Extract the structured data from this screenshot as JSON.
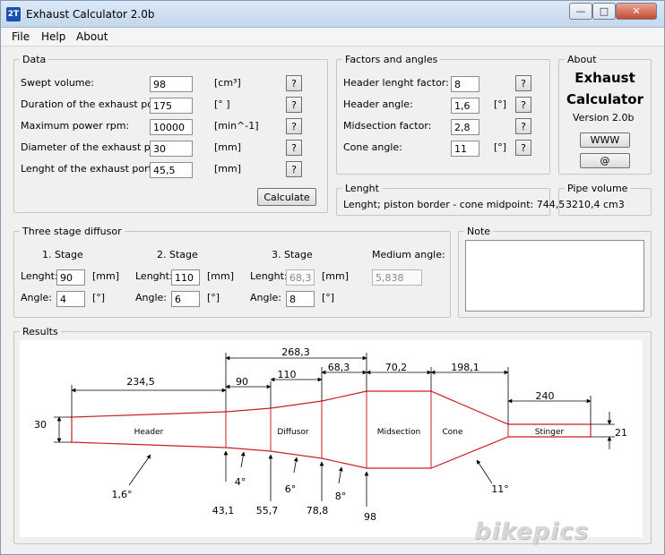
{
  "window": {
    "title": "Exhaust Calculator 2.0b",
    "icon": "2T"
  },
  "menu": [
    "File",
    "Help",
    "About"
  ],
  "data": {
    "legend": "Data",
    "rows": [
      {
        "label": "Swept volume:",
        "value": "98",
        "unit": "[cm³]"
      },
      {
        "label": "Duration of the exhaust port:",
        "value": "175",
        "unit": "[° ]"
      },
      {
        "label": "Maximum power rpm:",
        "value": "10000",
        "unit": "[min^-1]"
      },
      {
        "label": "Diameter of the exhaust port:",
        "value": "30",
        "unit": "[mm]"
      },
      {
        "label": "Lenght of the exhaust port:",
        "value": "45,5",
        "unit": "[mm]"
      }
    ],
    "help_label": "?",
    "calculate_label": "Calculate"
  },
  "factors": {
    "legend": "Factors and angles",
    "rows": [
      {
        "label": "Header lenght factor:",
        "value": "8",
        "unit": ""
      },
      {
        "label": "Header angle:",
        "value": "1,6",
        "unit": "[°]"
      },
      {
        "label": "Midsection factor:",
        "value": "2,8",
        "unit": ""
      },
      {
        "label": "Cone angle:",
        "value": "11",
        "unit": "[°]"
      }
    ]
  },
  "about": {
    "legend": "About",
    "title1": "Exhaust",
    "title2": "Calculator",
    "version": "Version 2.0b",
    "www_label": "WWW",
    "at_label": "@"
  },
  "lenght": {
    "legend": "Lenght",
    "text": "Lenght; piston border - cone midpoint:  744,5"
  },
  "pipe_volume": {
    "legend": "Pipe volume",
    "value": "3210,4 cm3"
  },
  "diffusor": {
    "legend": "Three stage diffusor",
    "stage1": "1. Stage",
    "stage2": "2. Stage",
    "stage3": "3. Stage",
    "medium_angle": "Medium angle:",
    "lenght_label": "Lenght:",
    "angle_label": "Angle:",
    "mm": "[mm]",
    "deg": "[°]",
    "l1": "90",
    "a1": "4",
    "l2": "110",
    "a2": "6",
    "l3": "68,3",
    "a3": "8",
    "medium": "5,838"
  },
  "note": {
    "legend": "Note"
  },
  "results": {
    "legend": "Results",
    "dims": {
      "total": "268,3",
      "header_len": "234,5",
      "stage1": "90",
      "stage2": "110",
      "stage3": "68,3",
      "mid": "70,2",
      "cone": "198,1",
      "stinger": "240",
      "dia_in": "30",
      "dia_out": "21"
    },
    "sections": {
      "header": "Header",
      "diffusor": "Diffusor",
      "midsection": "Midsection",
      "cone": "Cone",
      "stinger": "Stinger"
    },
    "angles": {
      "header": "1,6°",
      "s1": "4°",
      "s2": "6°",
      "s3": "8°",
      "cone": "11°"
    },
    "positions": {
      "p1": "43,1",
      "p2": "55,7",
      "p3": "78,8",
      "p4": "98"
    },
    "outline_color": "#cc1f1f"
  },
  "watermark": "bikepics"
}
